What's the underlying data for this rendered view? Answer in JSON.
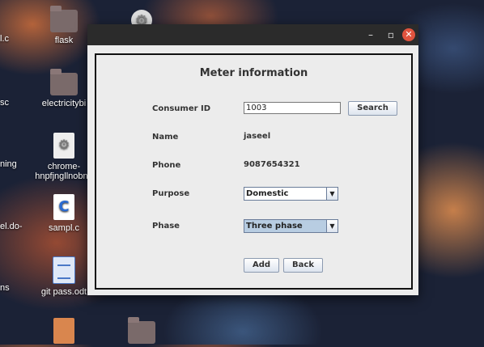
{
  "desktop": {
    "edge_labels": [
      "l.c",
      "sc",
      "ning",
      "el.do-",
      "ns"
    ],
    "items": [
      {
        "label": "flask",
        "icon": "folder-icon"
      },
      {
        "label": "electricitybi",
        "icon": "folder-icon"
      },
      {
        "label": "chrome-",
        "label2": "hnpfjngllnobne",
        "icon": "chrome-app-icon"
      },
      {
        "label": "sampl.c",
        "icon": "c-file-icon"
      },
      {
        "label": "git pass.odt",
        "icon": "document-icon"
      }
    ]
  },
  "window": {
    "controls": {
      "minimize": "–",
      "maximize": "▫",
      "close": "✕"
    },
    "title": "Meter information",
    "fields": {
      "consumer_id_label": "Consumer ID",
      "consumer_id_value": "1003",
      "name_label": "Name",
      "name_value": "jaseel",
      "phone_label": "Phone",
      "phone_value": "9087654321",
      "purpose_label": "Purpose",
      "purpose_value": "Domestic",
      "phase_label": "Phase",
      "phase_value": "Three phase"
    },
    "buttons": {
      "search": "Search",
      "add": "Add",
      "back": "Back"
    }
  }
}
